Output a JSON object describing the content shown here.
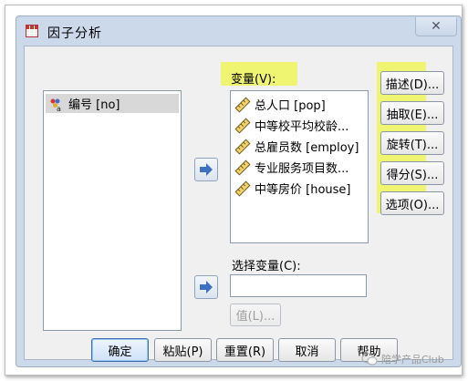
{
  "window": {
    "title": "因子分析",
    "close_glyph": "✕"
  },
  "source_list": {
    "items": [
      {
        "label": "编号 [no]",
        "icon": "nominal-variable-icon"
      }
    ]
  },
  "variables": {
    "label": "变量(V):",
    "items": [
      {
        "label": "总人口 [pop]",
        "icon": "scale-variable-icon"
      },
      {
        "label": "中等校平均校龄...",
        "icon": "scale-variable-icon"
      },
      {
        "label": "总雇员数 [employ]",
        "icon": "scale-variable-icon"
      },
      {
        "label": "专业服务项目数...",
        "icon": "scale-variable-icon"
      },
      {
        "label": "中等房价 [house]",
        "icon": "scale-variable-icon"
      }
    ]
  },
  "selection_variable": {
    "label": "选择变量(C):",
    "value": "",
    "value_button": "值(L)..."
  },
  "side_buttons": [
    {
      "label": "描述(D)..."
    },
    {
      "label": "抽取(E)..."
    },
    {
      "label": "旋转(T)..."
    },
    {
      "label": "得分(S)..."
    },
    {
      "label": "选项(O)..."
    }
  ],
  "bottom_buttons": {
    "ok": "确定",
    "paste": "粘贴(P)",
    "reset": "重置(R)",
    "cancel": "取消",
    "help": "帮助"
  },
  "watermark": "陪学产品Club",
  "colors": {
    "highlight": "#eef55a",
    "arrow_blue": "#3e6fc0",
    "dialog_bg": "#ccd9ea"
  }
}
